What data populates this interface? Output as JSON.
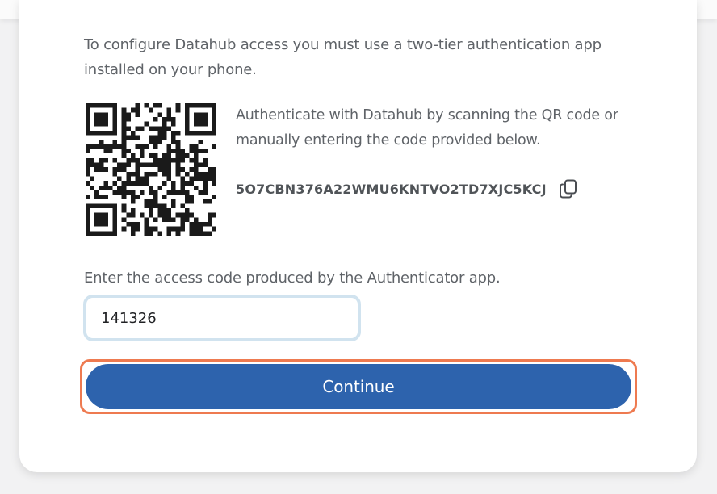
{
  "setup": {
    "intro": "To configure Datahub access you must use a two-tier authentication app installed on your phone.",
    "qr_instructions": "Authenticate with Datahub by scanning the QR code or manually entering the code provided below.",
    "secret_key": "5O7CBN376A22WMU6KNTVO2TD7XJC5KCJ",
    "copy_icon": "copy-icon",
    "qr_icon": "qr-code"
  },
  "verify": {
    "label": "Enter the access code produced by the Authenticator app.",
    "code_value": "141326",
    "continue_label": "Continue"
  },
  "colors": {
    "accent": "#2d63ad",
    "focus_ring": "#ee7a50",
    "input_border": "#d1e3ef"
  }
}
